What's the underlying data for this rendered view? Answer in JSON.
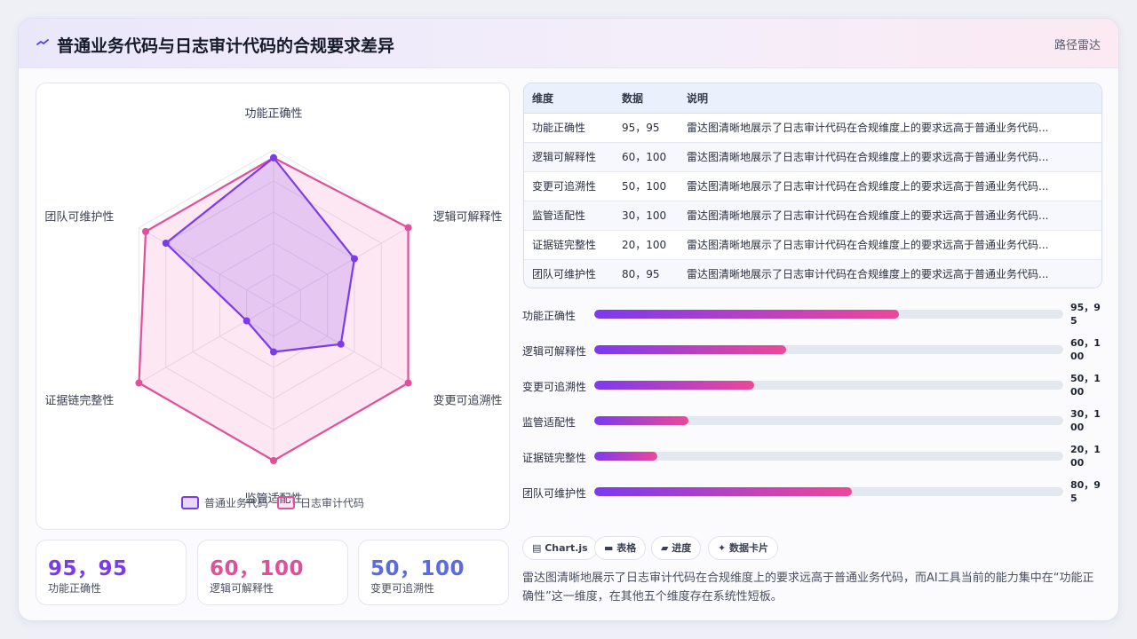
{
  "header": {
    "title": "普通业务代码与日志审计代码的合规要求差异",
    "tag": "路径雷达"
  },
  "chart_data": {
    "type": "radar",
    "axes": [
      "功能正确性",
      "逻辑可解释性",
      "变更可追溯性",
      "监管适配性",
      "证据链完整性",
      "团队可维护性"
    ],
    "range": [
      0,
      100
    ],
    "rings": 5,
    "series": [
      {
        "name": "普通业务代码",
        "values": [
          95,
          60,
          50,
          30,
          20,
          80
        ],
        "color": "#7c3aed"
      },
      {
        "name": "日志审计代码",
        "values": [
          95,
          100,
          100,
          100,
          100,
          95
        ],
        "color": "#e0509a"
      }
    ],
    "legend_position": "bottom"
  },
  "table": {
    "headers": [
      "维度",
      "数据",
      "说明"
    ],
    "rows": [
      [
        "功能正确性",
        "95，95",
        "雷达图清晰地展示了日志审计代码在合规维度上的要求远高于普通业务代码..."
      ],
      [
        "逻辑可解释性",
        "60，100",
        "雷达图清晰地展示了日志审计代码在合规维度上的要求远高于普通业务代码..."
      ],
      [
        "变更可追溯性",
        "50，100",
        "雷达图清晰地展示了日志审计代码在合规维度上的要求远高于普通业务代码..."
      ],
      [
        "监管适配性",
        "30，100",
        "雷达图清晰地展示了日志审计代码在合规维度上的要求远高于普通业务代码..."
      ],
      [
        "证据链完整性",
        "20，100",
        "雷达图清晰地展示了日志审计代码在合规维度上的要求远高于普通业务代码..."
      ],
      [
        "团队可维护性",
        "80，95",
        "雷达图清晰地展示了日志审计代码在合规维度上的要求远高于普通业务代码..."
      ]
    ]
  },
  "bars": [
    {
      "label": "功能正确性",
      "value_text": "95，95",
      "fill": 0.65
    },
    {
      "label": "逻辑可解释性",
      "value_text": "60，100",
      "fill": 0.41
    },
    {
      "label": "变更可追溯性",
      "value_text": "50，100",
      "fill": 0.34
    },
    {
      "label": "监管适配性",
      "value_text": "30，100",
      "fill": 0.2
    },
    {
      "label": "证据链完整性",
      "value_text": "20，100",
      "fill": 0.135
    },
    {
      "label": "团队可维护性",
      "value_text": "80，95",
      "fill": 0.55
    }
  ],
  "kpis": [
    {
      "value": "95，95",
      "label": "功能正确性",
      "color": "#7c3aed"
    },
    {
      "value": "60，100",
      "label": "逻辑可解释性",
      "color": "#e0509a"
    },
    {
      "value": "50，100",
      "label": "变更可追溯性",
      "color": "#5b6be0"
    }
  ],
  "chips": [
    {
      "icon": "chart-icon",
      "label": "▤ Chart.js"
    },
    {
      "icon": "table-icon",
      "label": "▬ 表格"
    },
    {
      "icon": "progress-icon",
      "label": "▰ 进度"
    },
    {
      "icon": "card-icon",
      "label": "✦ 数据卡片"
    }
  ],
  "description": "雷达图清晰地展示了日志审计代码在合规维度上的要求远高于普通业务代码，而AI工具当前的能力集中在“功能正确性”这一维度，在其他五个维度存在系统性短板。"
}
